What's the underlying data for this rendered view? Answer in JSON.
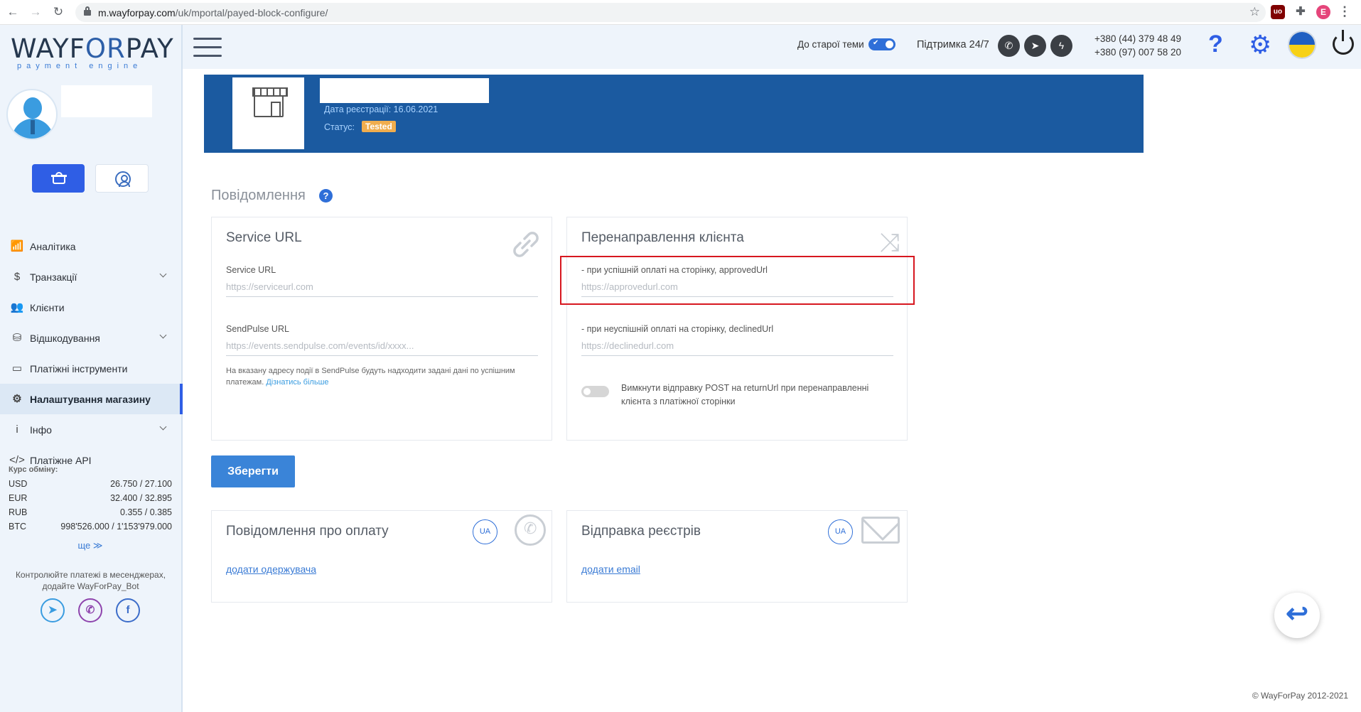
{
  "browser": {
    "url_host": "m.wayforpay.com",
    "url_path": "/uk/mportal/payed-block-configure/",
    "profile_initial": "E",
    "ext_label": "uo"
  },
  "logo": {
    "main_a": "WAYF",
    "main_b": "OR",
    "main_c": "PAY",
    "sub": "payment engine"
  },
  "sidebar": {
    "items": [
      {
        "label": "Аналітика",
        "icon": "chart-icon",
        "glyph": "📶",
        "chevron": false
      },
      {
        "label": "Транзакції",
        "icon": "dollar-icon",
        "glyph": "$",
        "chevron": true
      },
      {
        "label": "Клієнти",
        "icon": "users-icon",
        "glyph": "👥",
        "chevron": false
      },
      {
        "label": "Відшкодування",
        "icon": "coins-icon",
        "glyph": "⛁",
        "chevron": true
      },
      {
        "label": "Платіжні інструменти",
        "icon": "card-icon",
        "glyph": "▭",
        "chevron": false
      },
      {
        "label": "Налаштування магазину",
        "icon": "gear-icon",
        "glyph": "⚙",
        "chevron": false,
        "active": true
      },
      {
        "label": "Інфо",
        "icon": "info-icon",
        "glyph": "i",
        "chevron": true
      },
      {
        "label": "Платіжне API",
        "icon": "code-icon",
        "glyph": "</>",
        "chevron": false
      }
    ],
    "rates_title": "Курс обміну:",
    "rates": [
      {
        "cur": "USD",
        "val": "26.750 / 27.100"
      },
      {
        "cur": "EUR",
        "val": "32.400 / 32.895"
      },
      {
        "cur": "RUB",
        "val": "0.355 / 0.385"
      },
      {
        "cur": "BTC",
        "val": "998'526.000 / 1'153'979.000"
      }
    ],
    "rates_more": "ще ≫",
    "bot_text": "Контролюйте платежі в месенджерах, додайте WayForPay_Bot"
  },
  "header": {
    "old_theme": "До старої теми",
    "support": "Підтримка 24/7",
    "phone1": "+380 (44) 379 48 49",
    "phone2": "+380 (97) 007 58 20",
    "help": "?",
    "gear": "⚙"
  },
  "shop": {
    "reg_date": "Дата реєстрації: 16.06.2021",
    "status_label": "Статус:",
    "status": "Tested"
  },
  "section": {
    "title": "Повідомлення",
    "help": "?"
  },
  "service_card": {
    "title": "Service URL",
    "service_label": "Service URL",
    "service_placeholder": "https://serviceurl.com",
    "sendpulse_label": "SendPulse URL",
    "sendpulse_placeholder": "https://events.sendpulse.com/events/id/xxxx...",
    "hint": "На вказану адресу події в SendPulse будуть надходити задані дані по успішним платежам.",
    "hint_link": "Дізнатись більше"
  },
  "redirect_card": {
    "title": "Перенаправлення клієнта",
    "approved_label": "- при успішній оплаті на сторінку, approvedUrl",
    "approved_placeholder": "https://approvedurl.com",
    "declined_label": "- при неуспішній оплаті на сторінку, declinedUrl",
    "declined_placeholder": "https://declinedurl.com",
    "toggle_text": "Вимкнути відправку POST на returnUrl при перенаправленні клієнта з платіжної сторінки"
  },
  "save_button": "Зберегти",
  "payment_notify_card": {
    "title": "Повідомлення про оплату",
    "badge": "UA",
    "link": "додати одержувача"
  },
  "registry_card": {
    "title": "Відправка реєстрів",
    "badge": "UA",
    "link": "додати email"
  },
  "copyright": "© WayForPay 2012-2021"
}
